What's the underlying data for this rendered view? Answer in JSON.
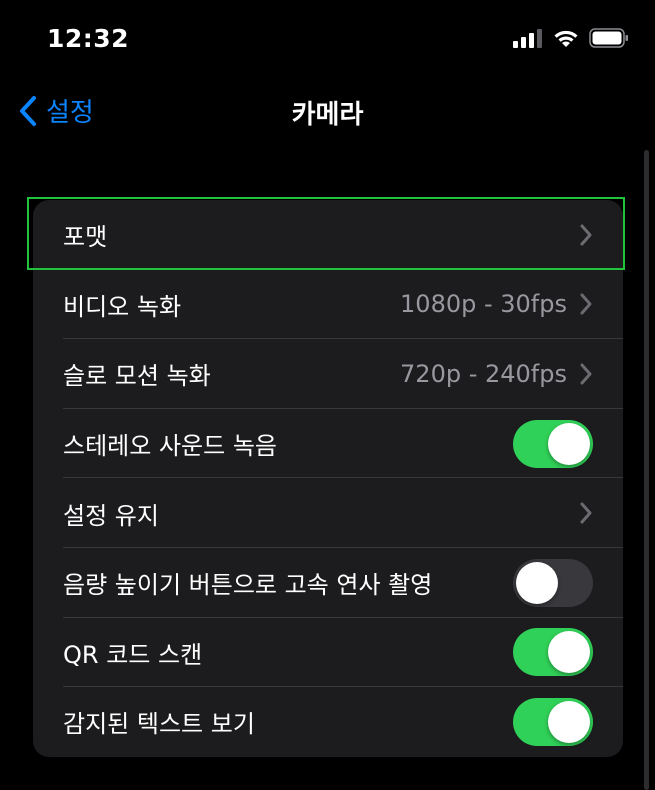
{
  "status_bar": {
    "time": "12:32",
    "icons": [
      "cellular-signal-icon",
      "wifi-icon",
      "battery-icon"
    ]
  },
  "nav": {
    "back_label": "설정",
    "title": "카메라"
  },
  "colors": {
    "accent": "#0a84ff",
    "toggle_on": "#30d158",
    "toggle_off": "#39393d",
    "highlight": "#22c33c"
  },
  "settings": {
    "rows": [
      {
        "label": "포맷",
        "value": "",
        "control": "chevron"
      },
      {
        "label": "비디오 녹화",
        "value": "1080p - 30fps",
        "control": "chevron"
      },
      {
        "label": "슬로 모션 녹화",
        "value": "720p - 240fps",
        "control": "chevron"
      },
      {
        "label": "스테레오 사운드 녹음",
        "value": "",
        "control": "toggle",
        "on": true
      },
      {
        "label": "설정 유지",
        "value": "",
        "control": "chevron"
      },
      {
        "label": "음량 높이기 버튼으로 고속 연사 촬영",
        "value": "",
        "control": "toggle",
        "on": false
      },
      {
        "label": "QR 코드 스캔",
        "value": "",
        "control": "toggle",
        "on": true
      },
      {
        "label": "감지된 텍스트 보기",
        "value": "",
        "control": "toggle",
        "on": true
      }
    ]
  }
}
